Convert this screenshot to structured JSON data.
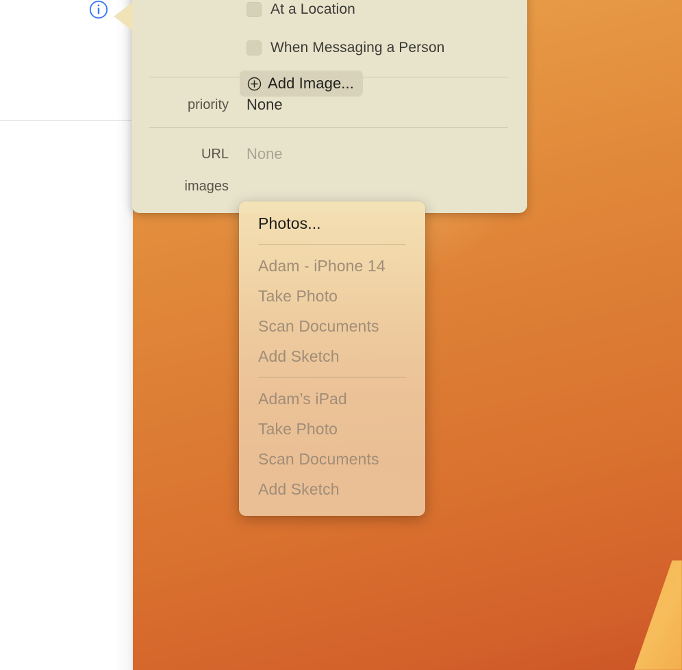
{
  "window": {
    "background_color": "#ffffff",
    "info_button": {
      "icon": "info-circle-icon",
      "color": "#3b7af7",
      "label": "i"
    }
  },
  "wallpaper": {
    "type": "gradient",
    "top_color": "#eaa54f",
    "bottom_color": "#cc5527",
    "accent_wedge_color": "#f6b752"
  },
  "popover": {
    "background_color": "#e8e3cb",
    "checkboxes": [
      {
        "label": "At a Location",
        "checked": false
      },
      {
        "label": "When Messaging a Person",
        "checked": false
      }
    ],
    "fields": [
      {
        "label": "priority",
        "value": "None",
        "placeholder": false
      },
      {
        "label": "URL",
        "value": "None",
        "placeholder": true
      }
    ],
    "images_row": {
      "label": "images",
      "button": {
        "label": "Add Image...",
        "icon": "plus-circle-icon"
      }
    }
  },
  "menu": {
    "background_color": "#f2ddb2",
    "items": [
      {
        "label": "Photos...",
        "enabled": true,
        "type": "item"
      },
      {
        "type": "separator"
      },
      {
        "label": "Adam - iPhone 14",
        "enabled": false,
        "type": "header"
      },
      {
        "label": "Take Photo",
        "enabled": false,
        "type": "item"
      },
      {
        "label": "Scan Documents",
        "enabled": false,
        "type": "item"
      },
      {
        "label": "Add Sketch",
        "enabled": false,
        "type": "item"
      },
      {
        "type": "separator"
      },
      {
        "label": "Adam’s iPad",
        "enabled": false,
        "type": "header"
      },
      {
        "label": "Take Photo",
        "enabled": false,
        "type": "item"
      },
      {
        "label": "Scan Documents",
        "enabled": false,
        "type": "item"
      },
      {
        "label": "Add Sketch",
        "enabled": false,
        "type": "item"
      }
    ]
  }
}
